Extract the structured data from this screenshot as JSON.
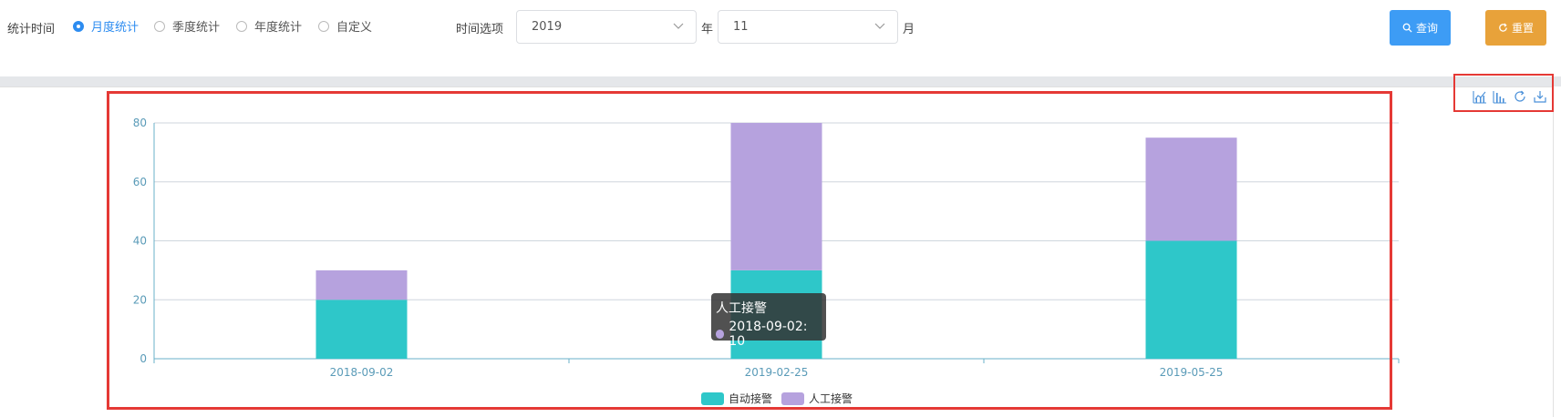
{
  "filter": {
    "stat_time_label": "统计时间",
    "options": [
      {
        "label": "月度统计",
        "checked": true
      },
      {
        "label": "季度统计",
        "checked": false
      },
      {
        "label": "年度统计",
        "checked": false
      },
      {
        "label": "自定义",
        "checked": false
      }
    ],
    "time_option_label": "时间选项",
    "year_value": "2019",
    "year_unit": "年",
    "month_value": "11",
    "month_unit": "月",
    "query_label": "查询",
    "reset_label": "重置"
  },
  "colors": {
    "accent": "#2d8cf0",
    "query": "#3d9cf5",
    "reset": "#e8a23a",
    "series_auto": "#2ec7c9",
    "series_manual": "#b6a2de",
    "highlight_frame": "#e53935"
  },
  "toolbox": {
    "icons": [
      "line-chart-icon",
      "bar-chart-icon",
      "restore-icon",
      "save-image-icon"
    ]
  },
  "tooltip": {
    "title": "人工接警",
    "text": "2018-09-02: 10"
  },
  "chart_data": {
    "type": "bar",
    "stacked": true,
    "categories": [
      "2018-09-02",
      "2019-02-25",
      "2019-05-25"
    ],
    "series": [
      {
        "name": "自动接警",
        "values": [
          20,
          30,
          40
        ],
        "color": "#2ec7c9"
      },
      {
        "name": "人工接警",
        "values": [
          10,
          50,
          35
        ],
        "color": "#b6a2de"
      }
    ],
    "ylim": [
      0,
      80
    ],
    "yticks": [
      0,
      20,
      40,
      60,
      80
    ],
    "grid": true,
    "legend_position": "bottom-center"
  }
}
